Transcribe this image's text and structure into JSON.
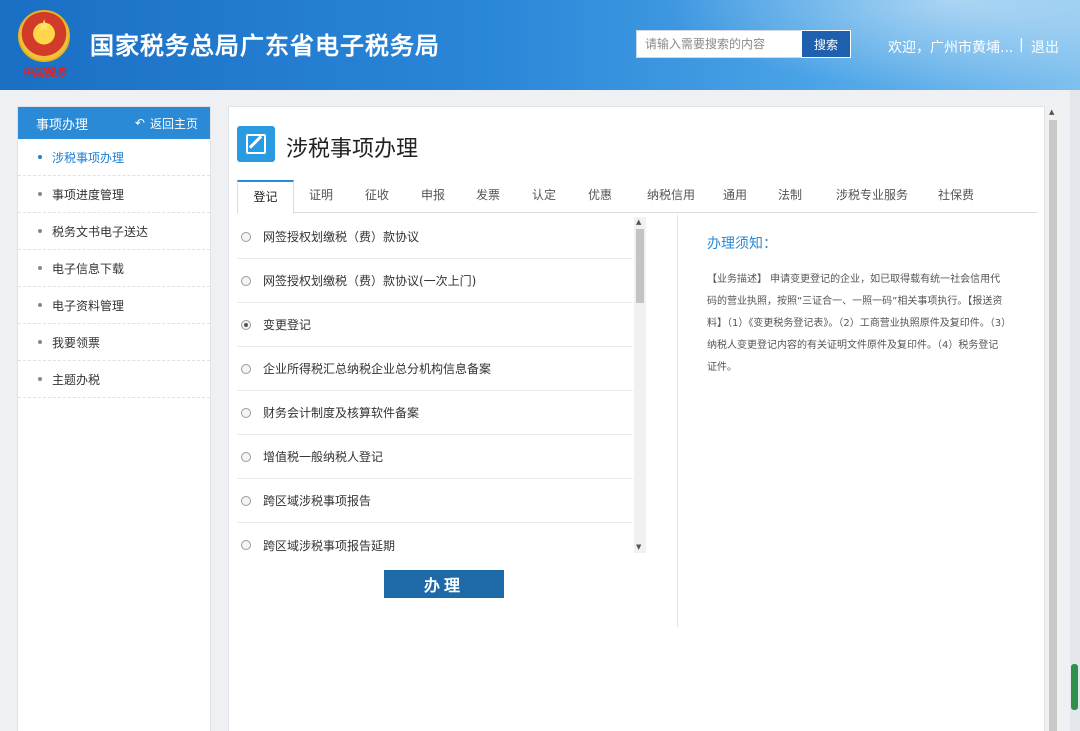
{
  "header": {
    "emblem_text": "中国税务",
    "title": "国家税务总局广东省电子税务局",
    "search_placeholder": "请输入需要搜索的内容",
    "search_button": "搜索",
    "welcome": "欢迎，广州市黄埔...",
    "separator": "|",
    "logout": "退出"
  },
  "sidebar": {
    "heading": "事项办理",
    "back_home": "返回主页",
    "items": [
      {
        "label": "涉税事项办理",
        "active": true
      },
      {
        "label": "事项进度管理"
      },
      {
        "label": "税务文书电子送达"
      },
      {
        "label": "电子信息下载"
      },
      {
        "label": "电子资料管理"
      },
      {
        "label": "我要领票"
      },
      {
        "label": "主题办税"
      }
    ]
  },
  "main": {
    "title": "涉税事项办理",
    "tabs": [
      "登记",
      "证明",
      "征收",
      "申报",
      "发票",
      "认定",
      "优惠",
      "纳税信用",
      "通用",
      "法制",
      "涉税专业服务",
      "社保费"
    ],
    "active_tab": "登记",
    "options": [
      {
        "label": "网签授权划缴税（费）款协议",
        "selected": false
      },
      {
        "label": "网签授权划缴税（费）款协议(一次上门)",
        "selected": false
      },
      {
        "label": "变更登记",
        "selected": true
      },
      {
        "label": "企业所得税汇总纳税企业总分机构信息备案",
        "selected": false
      },
      {
        "label": "财务会计制度及核算软件备案",
        "selected": false
      },
      {
        "label": "增值税一般纳税人登记",
        "selected": false
      },
      {
        "label": "跨区域涉税事项报告",
        "selected": false
      },
      {
        "label": "跨区域涉税事项报告延期",
        "selected": false
      }
    ],
    "submit_label": "办理",
    "notice": {
      "title": "办理须知：",
      "body": "【业务描述】 申请变更登记的企业，如已取得载有统一社会信用代码的营业执照，按照“三证合一、一照一码”相关事项执行。【报送资料】（1）《变更税务登记表》。（2）工商营业执照原件及复印件。（3）纳税人变更登记内容的有关证明文件原件及复印件。（4）税务登记证件。"
    }
  }
}
